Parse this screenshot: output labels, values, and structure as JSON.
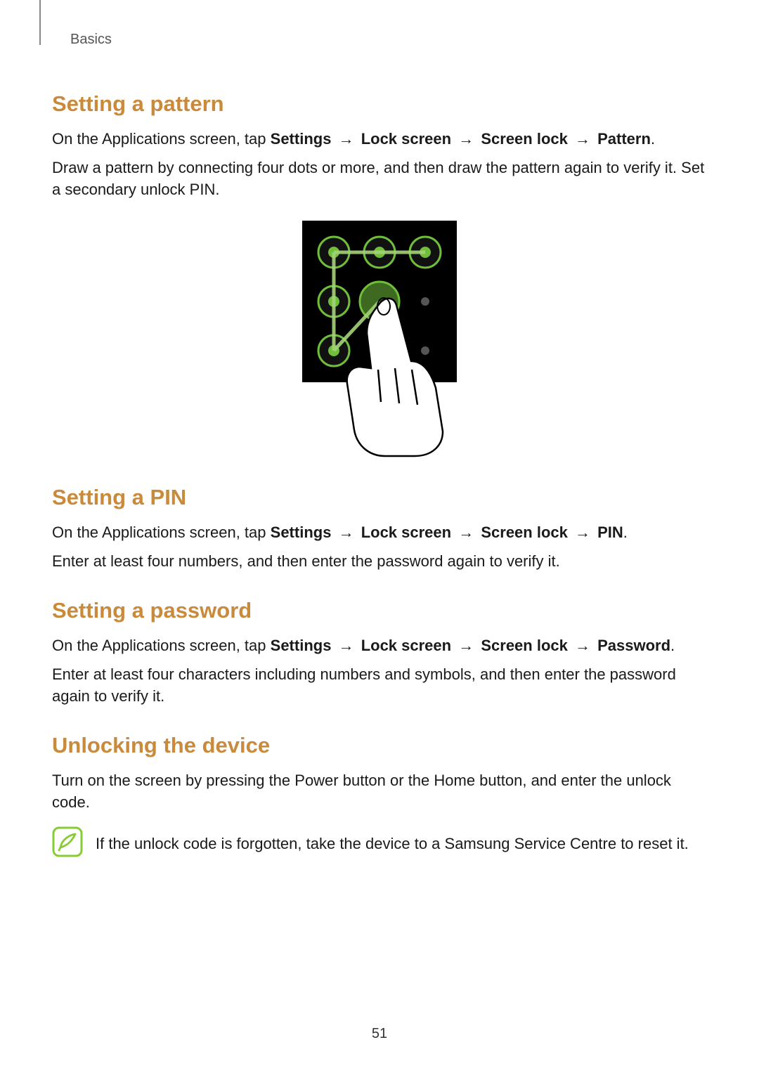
{
  "breadcrumb": "Basics",
  "sections": {
    "pattern": {
      "heading": "Setting a pattern",
      "intro_prefix": "On the Applications screen, tap ",
      "path": [
        "Settings",
        "Lock screen",
        "Screen lock",
        "Pattern"
      ],
      "body": "Draw a pattern by connecting four dots or more, and then draw the pattern again to verify it. Set a secondary unlock PIN."
    },
    "pin": {
      "heading": "Setting a PIN",
      "intro_prefix": "On the Applications screen, tap ",
      "path": [
        "Settings",
        "Lock screen",
        "Screen lock",
        "PIN"
      ],
      "body": "Enter at least four numbers, and then enter the password again to verify it."
    },
    "password": {
      "heading": "Setting a password",
      "intro_prefix": "On the Applications screen, tap ",
      "path": [
        "Settings",
        "Lock screen",
        "Screen lock",
        "Password"
      ],
      "body": "Enter at least four characters including numbers and symbols, and then enter the password again to verify it."
    },
    "unlock": {
      "heading": "Unlocking the device",
      "body": "Turn on the screen by pressing the Power button or the Home button, and enter the unlock code."
    }
  },
  "arrow": "→",
  "note": "If the unlock code is forgotten, take the device to a Samsung Service Centre to reset it.",
  "page_number": "51",
  "colors": {
    "heading": "#c98a3b",
    "note_icon": "#88cc33"
  }
}
